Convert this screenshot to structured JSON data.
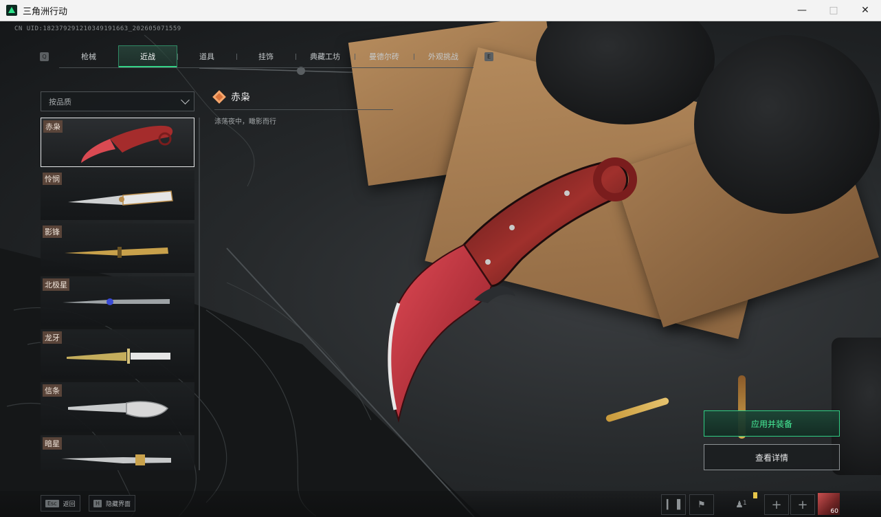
{
  "window": {
    "title": "三角洲行动",
    "minimize_icon": "minimize-icon",
    "maximize_icon": "maximize-icon",
    "close_icon": "close-icon"
  },
  "uid_text": "CN UID:18237929121034919166​3_202605071559",
  "tabs": {
    "left_key": "Q",
    "right_key": "E",
    "items": [
      {
        "label": "枪械",
        "active": false
      },
      {
        "label": "近战",
        "active": true
      },
      {
        "label": "道具",
        "active": false
      },
      {
        "label": "挂饰",
        "active": false
      },
      {
        "label": "典藏工坊",
        "active": false
      },
      {
        "label": "曼德尔砖",
        "active": false
      },
      {
        "label": "外观挑战",
        "active": false
      }
    ]
  },
  "filter": {
    "label": "按品质"
  },
  "list": {
    "items": [
      {
        "label": "赤枭",
        "selected": true
      },
      {
        "label": "怜悯",
        "selected": false
      },
      {
        "label": "影锋",
        "selected": false
      },
      {
        "label": "北极星",
        "selected": false
      },
      {
        "label": "龙牙",
        "selected": false
      },
      {
        "label": "信条",
        "selected": false
      },
      {
        "label": "暗星",
        "selected": false
      }
    ]
  },
  "detail": {
    "name": "赤枭",
    "description": "涤荡夜中，瞰影而行",
    "rarity_color": "#d9733a"
  },
  "actions": {
    "apply_label": "应用并装备",
    "details_label": "查看详情",
    "accent": "#2fcf84"
  },
  "bottom": {
    "back_key": "Esc",
    "back_label": "返回",
    "hide_key": "H",
    "hide_label": "隐藏界面",
    "friends_count": "1",
    "avatar_level": "60"
  }
}
